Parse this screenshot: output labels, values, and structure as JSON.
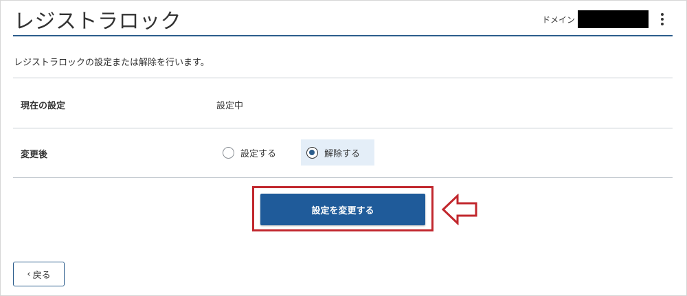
{
  "header": {
    "title": "レジストラロック",
    "domain_label": "ドメイン",
    "domain_value_redacted": true,
    "menu_icon": "kebab-menu-icon"
  },
  "description": "レジストラロックの設定または解除を行います。",
  "settings": {
    "current": {
      "label": "現在の設定",
      "value": "設定中"
    },
    "after": {
      "label": "変更後",
      "options": [
        {
          "label": "設定する",
          "selected": false
        },
        {
          "label": "解除する",
          "selected": true
        }
      ]
    }
  },
  "actions": {
    "submit_label": "設定を変更する",
    "back_label": "戻る",
    "back_icon": "chevron-left-icon"
  },
  "annotations": {
    "highlight_color": "#c1272d",
    "arrow_icon": "left-arrow-outline-icon"
  },
  "colors": {
    "primary": "#1f5b9a",
    "accent_rule": "#2b5d8c",
    "selected_bg": "#e4eef8"
  }
}
